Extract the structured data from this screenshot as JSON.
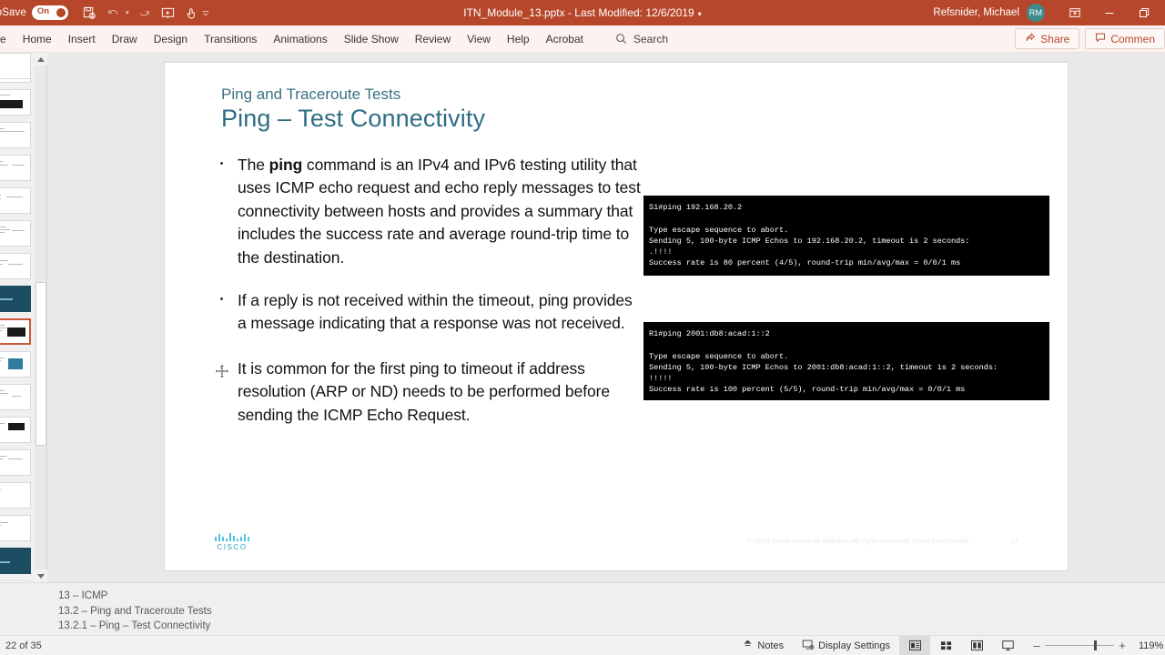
{
  "titlebar": {
    "autosave_label": "utoSave",
    "autosave_state": "On",
    "document_title": "ITN_Module_13.pptx  -  Last Modified: 12/6/2019",
    "user_name": "Refsnider, Michael",
    "user_initials": "RM",
    "qat": [
      {
        "name": "save-icon",
        "label": "Save"
      },
      {
        "name": "undo-icon",
        "label": "Undo"
      },
      {
        "name": "redo-icon",
        "label": "Redo"
      },
      {
        "name": "start-slideshow-icon",
        "label": "Start From Beginning"
      },
      {
        "name": "touch-mode-icon",
        "label": "Touch/Mouse Mode"
      }
    ],
    "window_buttons": [
      "restore-down",
      "minimize",
      "maximize"
    ],
    "accent_color": "#b7472a"
  },
  "ribbon": {
    "first_tab_truncated": "e",
    "tabs": [
      "Home",
      "Insert",
      "Draw",
      "Design",
      "Transitions",
      "Animations",
      "Slide Show",
      "Review",
      "View",
      "Help",
      "Acrobat"
    ],
    "search_placeholder": "Search",
    "share_label": "Share",
    "comments_label": "Commen"
  },
  "slide": {
    "eyebrow": "Ping and Traceroute Tests",
    "title": "Ping – Test Connectivity",
    "bullets": [
      {
        "pre": "The ",
        "bold": "ping",
        "post": " command is an IPv4 and IPv6 testing utility that uses ICMP echo request and echo reply messages to test connectivity between hosts and provides a summary that includes the success rate and average round-trip time to the destination."
      },
      {
        "pre": "If a reply is not received within the timeout, ping provides a message indicating that a response was not received.",
        "bold": "",
        "post": ""
      },
      {
        "pre": "It is common for the first ping to timeout if address resolution (ARP or ND) needs to be performed before sending the ICMP Echo Request.",
        "bold": "",
        "post": ""
      }
    ],
    "terminal_ipv4": "S1#ping 192.168.20.2\n\nType escape sequence to abort.\nSending 5, 100-byte ICMP Echos to 192.168.20.2, timeout is 2 seconds:\n.!!!!\nSuccess rate is 80 percent (4/5), round-trip min/avg/max = 0/0/1 ms",
    "terminal_ipv6": "R1#ping 2001:db8:acad:1::2\n\nType escape sequence to abort.\nSending 5, 100-byte ICMP Echos to 2001:db8:acad:1::2, timeout is 2 seconds:\n!!!!!\nSuccess rate is 100 percent (5/5), round-trip min/avg/max = 0/0/1 ms",
    "logo_word": "CISCO",
    "copyright": "© 2016  Cisco and/or its affiliates. All rights reserved.    Cisco Confidential",
    "page_number": "22",
    "title_color": "#2e6d83",
    "eyebrow_color": "#3a7183"
  },
  "outline": {
    "lines": [
      "13 – ICMP",
      "13.2 – Ping and Traceroute Tests",
      "13.2.1 – Ping – Test Connectivity"
    ]
  },
  "statusbar": {
    "slide_counter": "22 of 35",
    "notes_label": "Notes",
    "display_settings_label": "Display Settings",
    "views": [
      {
        "name": "normal-view-icon",
        "active": true
      },
      {
        "name": "slide-sorter-view-icon",
        "active": false
      },
      {
        "name": "reading-view-icon",
        "active": false
      },
      {
        "name": "slideshow-view-icon",
        "active": false
      }
    ],
    "zoom_out": "–",
    "zoom_in": "+",
    "zoom_level": "119%"
  },
  "thumbnails": {
    "selected_index": 8,
    "count": 20
  }
}
